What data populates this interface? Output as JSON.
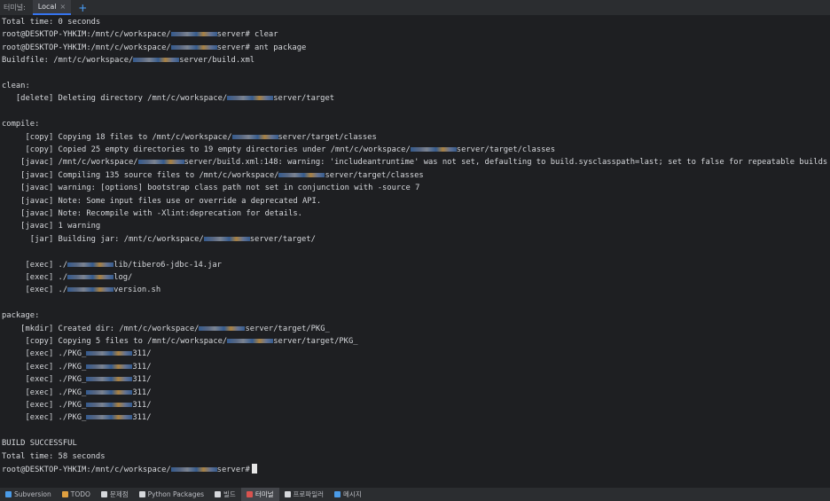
{
  "tabbar": {
    "title": "터미널:",
    "tab_label": "Local",
    "close_glyph": "×",
    "add_glyph": "+"
  },
  "terminal": {
    "lines": [
      {
        "text": "Total time: 0 seconds"
      },
      {
        "prefix": "root@DESKTOP-YHKIM:/mnt/c/workspace/",
        "suffix": "server# clear"
      },
      {
        "prefix": "root@DESKTOP-YHKIM:/mnt/c/workspace/",
        "suffix": "server# ant package"
      },
      {
        "prefix": "Buildfile: /mnt/c/workspace/",
        "suffix": "server/build.xml"
      },
      {
        "text": ""
      },
      {
        "text": "clean:"
      },
      {
        "prefix": "   [delete] Deleting directory /mnt/c/workspace/",
        "suffix": "server/target"
      },
      {
        "text": ""
      },
      {
        "text": "compile:"
      },
      {
        "prefix": "     [copy] Copying 18 files to /mnt/c/workspace/",
        "suffix": "server/target/classes"
      },
      {
        "prefix": "     [copy] Copied 25 empty directories to 19 empty directories under /mnt/c/workspace/",
        "suffix": "server/target/classes"
      },
      {
        "prefix": "    [javac] /mnt/c/workspace/",
        "suffix": "server/build.xml:148: warning: 'includeantruntime' was not set, defaulting to build.sysclasspath=last; set to false for repeatable builds"
      },
      {
        "prefix": "    [javac] Compiling 135 source files to /mnt/c/workspace/",
        "suffix": "server/target/classes"
      },
      {
        "text": "    [javac] warning: [options] bootstrap class path not set in conjunction with -source 7"
      },
      {
        "text": "    [javac] Note: Some input files use or override a deprecated API."
      },
      {
        "text": "    [javac] Note: Recompile with -Xlint:deprecation for details."
      },
      {
        "text": "    [javac] 1 warning"
      },
      {
        "prefix": "      [jar] Building jar: /mnt/c/workspace/",
        "suffix": "server/target/"
      },
      {
        "text": ""
      },
      {
        "prefix": "     [exec] ./",
        "suffix": "lib/tibero6-jdbc-14.jar"
      },
      {
        "prefix": "     [exec] ./",
        "suffix": "log/"
      },
      {
        "prefix": "     [exec] ./",
        "suffix": "version.sh"
      },
      {
        "text": ""
      },
      {
        "text": "package:"
      },
      {
        "prefix": "    [mkdir] Created dir: /mnt/c/workspace/",
        "suffix": "server/target/PKG_"
      },
      {
        "prefix": "     [copy] Copying 5 files to /mnt/c/workspace/",
        "suffix": "server/target/PKG_"
      },
      {
        "prefix": "     [exec] ./PKG_",
        "suffix": "311/"
      },
      {
        "prefix": "     [exec] ./PKG_",
        "suffix": "311/"
      },
      {
        "prefix": "     [exec] ./PKG_",
        "suffix": "311/"
      },
      {
        "prefix": "     [exec] ./PKG_",
        "suffix": "311/"
      },
      {
        "prefix": "     [exec] ./PKG_",
        "suffix": "311/"
      },
      {
        "prefix": "     [exec] ./PKG_",
        "suffix": "311/"
      },
      {
        "text": ""
      },
      {
        "text": "BUILD SUCCESSFUL"
      },
      {
        "text": "Total time: 58 seconds"
      },
      {
        "prefix": "root@DESKTOP-YHKIM:/mnt/c/workspace/",
        "suffix": "server#",
        "cursor": true
      }
    ]
  },
  "statusbar": {
    "items": [
      {
        "label": "Subversion",
        "icon": "subversion-icon",
        "color": "#4a9be8"
      },
      {
        "label": "TODO",
        "icon": "todo-icon",
        "color": "#e0a040"
      },
      {
        "label": "문제점",
        "icon": "problems-icon",
        "color": "#d6d8dc"
      },
      {
        "label": "Python Packages",
        "icon": "python-packages-icon",
        "color": "#d6d8dc"
      },
      {
        "label": "빌드",
        "icon": "build-icon",
        "color": "#d6d8dc"
      },
      {
        "label": "터미널",
        "icon": "terminal-icon",
        "color": "#d9534f",
        "active": true
      },
      {
        "label": "프로파일러",
        "icon": "profiler-icon",
        "color": "#d6d8dc"
      },
      {
        "label": "메시지",
        "icon": "messages-icon",
        "color": "#4a9be8"
      }
    ]
  }
}
